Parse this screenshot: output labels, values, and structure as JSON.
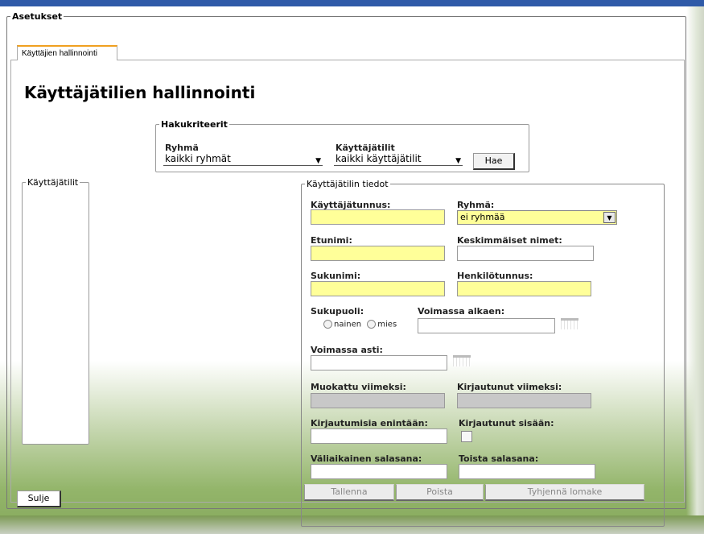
{
  "settings": {
    "title": "Asetukset"
  },
  "tabs": [
    {
      "label": "Käyttäjien hallinnointi"
    }
  ],
  "page": {
    "title": "Käyttäjätilien hallinnointi"
  },
  "search": {
    "legend": "Hakukriteerit",
    "group_label": "Ryhmä",
    "group_value": "kaikki ryhmät",
    "accounts_label": "Käyttäjätilit",
    "accounts_value": "kaikki käyttäjätilit",
    "search_button": "Hae"
  },
  "accounts_list": {
    "legend": "Käyttäjätilit"
  },
  "details": {
    "legend": "Käyttäjätilin tiedot",
    "username_label": "Käyttäjätunnus:",
    "group_label": "Ryhmä:",
    "group_value": "ei ryhmää",
    "firstname_label": "Etunimi:",
    "middlenames_label": "Keskimmäiset nimet:",
    "lastname_label": "Sukunimi:",
    "ssn_label": "Henkilötunnus:",
    "gender_label": "Sukupuoli:",
    "gender_female": "nainen",
    "gender_male": "mies",
    "valid_from_label": "Voimassa alkaen:",
    "valid_to_label": "Voimassa asti:",
    "modified_label": "Muokattu viimeksi:",
    "last_login_label": "Kirjautunut viimeksi:",
    "max_logins_label": "Kirjautumisia enintään:",
    "logged_in_label": "Kirjautunut sisään:",
    "temp_password_label": "Väliaikainen salasana:",
    "repeat_password_label": "Toista salasana:",
    "save_button": "Tallenna",
    "delete_button": "Poista",
    "clear_button": "Tyhjennä lomake"
  },
  "close_button": "Sulje"
}
